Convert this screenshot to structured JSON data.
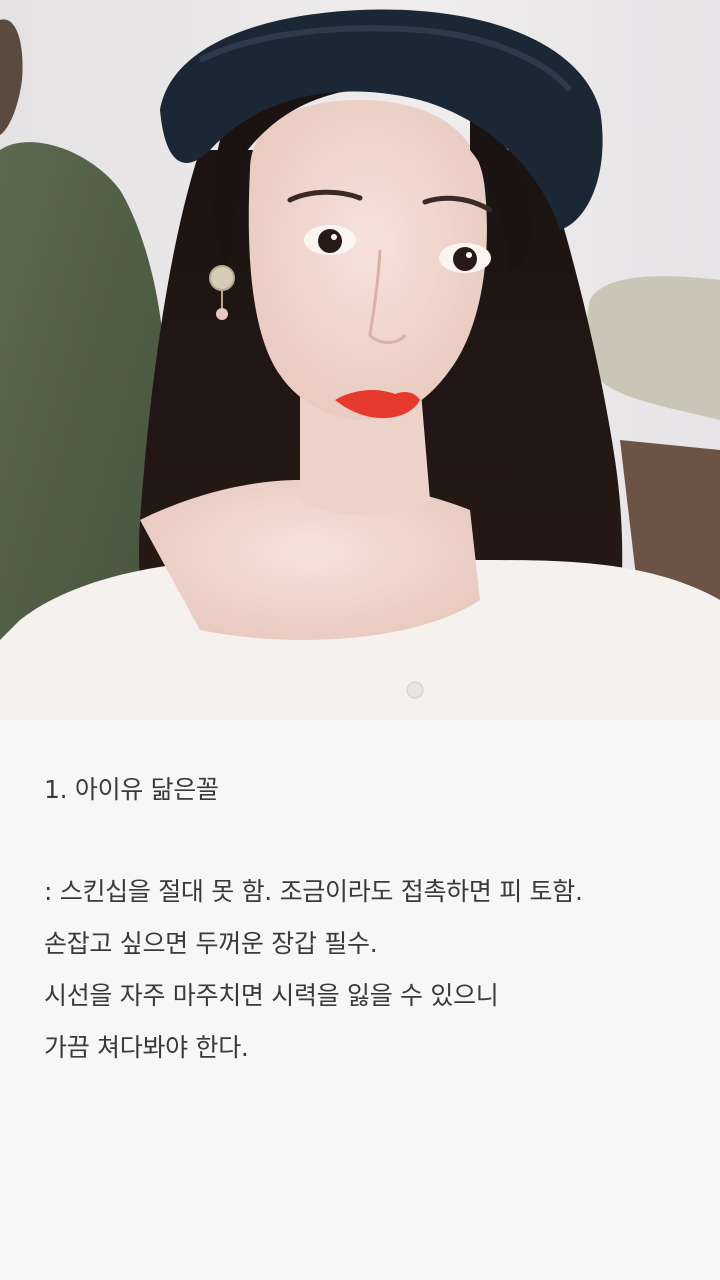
{
  "post": {
    "heading": "1. 아이유 닮은꼴",
    "lines": [
      ": 스킨십을 절대 못 함. 조금이라도 접촉하면 피 토함.",
      "손잡고 싶으면 두꺼운 장갑 필수.",
      "시선을 자주 마주치면 시력을 잃을 수 있으니",
      "가끔 쳐다봐야 한다."
    ]
  }
}
